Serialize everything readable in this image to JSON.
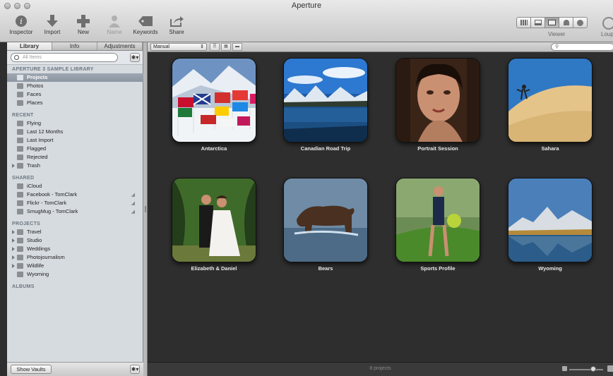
{
  "window": {
    "title": "Aperture"
  },
  "toolbar": {
    "tools": [
      {
        "label": "Inspector",
        "icon": "info-icon",
        "enabled": true
      },
      {
        "label": "Import",
        "icon": "import-arrow-icon",
        "enabled": true
      },
      {
        "label": "New",
        "icon": "plus-icon",
        "enabled": true
      },
      {
        "label": "Name",
        "icon": "person-icon",
        "enabled": false
      },
      {
        "label": "Keywords",
        "icon": "tag-icon",
        "enabled": true
      },
      {
        "label": "Share",
        "icon": "share-icon",
        "enabled": true
      }
    ],
    "viewer_label": "Viewer",
    "loupe_label": "Loup"
  },
  "sidebar": {
    "tabs": [
      "Library",
      "Info",
      "Adjustments"
    ],
    "active_tab": "Library",
    "search_placeholder": "All Items",
    "gear_glyph": "✱▾",
    "sections": [
      {
        "title": "APERTURE 3 SAMPLE LIBRARY",
        "items": [
          {
            "label": "Projects",
            "selected": true,
            "icon": "projects-icon"
          },
          {
            "label": "Photos",
            "icon": "photos-icon"
          },
          {
            "label": "Faces",
            "icon": "faces-icon"
          },
          {
            "label": "Places",
            "icon": "places-icon"
          }
        ]
      },
      {
        "title": "RECENT",
        "items": [
          {
            "label": "Flying",
            "icon": "project-icon"
          },
          {
            "label": "Last 12 Months",
            "icon": "calendar-icon"
          },
          {
            "label": "Last Import",
            "icon": "clock-icon"
          },
          {
            "label": "Flagged",
            "icon": "flag-icon"
          },
          {
            "label": "Rejected",
            "icon": "x-icon"
          },
          {
            "label": "Trash",
            "icon": "trash-icon",
            "disclosure": true
          }
        ]
      },
      {
        "title": "SHARED",
        "items": [
          {
            "label": "iCloud",
            "icon": "cloud-icon"
          },
          {
            "label": "Facebook - TomClark",
            "icon": "facebook-icon",
            "shared": true
          },
          {
            "label": "Flickr - TomClark",
            "icon": "flickr-icon",
            "shared": true
          },
          {
            "label": "SmugMug - TomClark",
            "icon": "smugmug-icon",
            "shared": true
          }
        ]
      },
      {
        "title": "PROJECTS",
        "items": [
          {
            "label": "Travel",
            "icon": "folder-icon",
            "disclosure": true
          },
          {
            "label": "Studio",
            "icon": "folder-icon",
            "disclosure": true
          },
          {
            "label": "Weddings",
            "icon": "folder-icon",
            "disclosure": true
          },
          {
            "label": "Photojournalism",
            "icon": "folder-icon",
            "disclosure": true
          },
          {
            "label": "Wildlife",
            "icon": "folder-icon",
            "disclosure": true
          },
          {
            "label": "Wyoming",
            "icon": "project-icon"
          }
        ]
      },
      {
        "title": "ALBUMS",
        "items": []
      }
    ],
    "show_vaults_label": "Show Vaults"
  },
  "browser": {
    "sort_value": "Manual",
    "projects": [
      {
        "label": "Antarctica"
      },
      {
        "label": "Canadian Road Trip"
      },
      {
        "label": "Portrait Session"
      },
      {
        "label": "Sahara"
      },
      {
        "label": "Elizabeth & Daniel"
      },
      {
        "label": "Bears"
      },
      {
        "label": "Sports Profile"
      },
      {
        "label": "Wyoming"
      }
    ],
    "status": "8 projects"
  }
}
